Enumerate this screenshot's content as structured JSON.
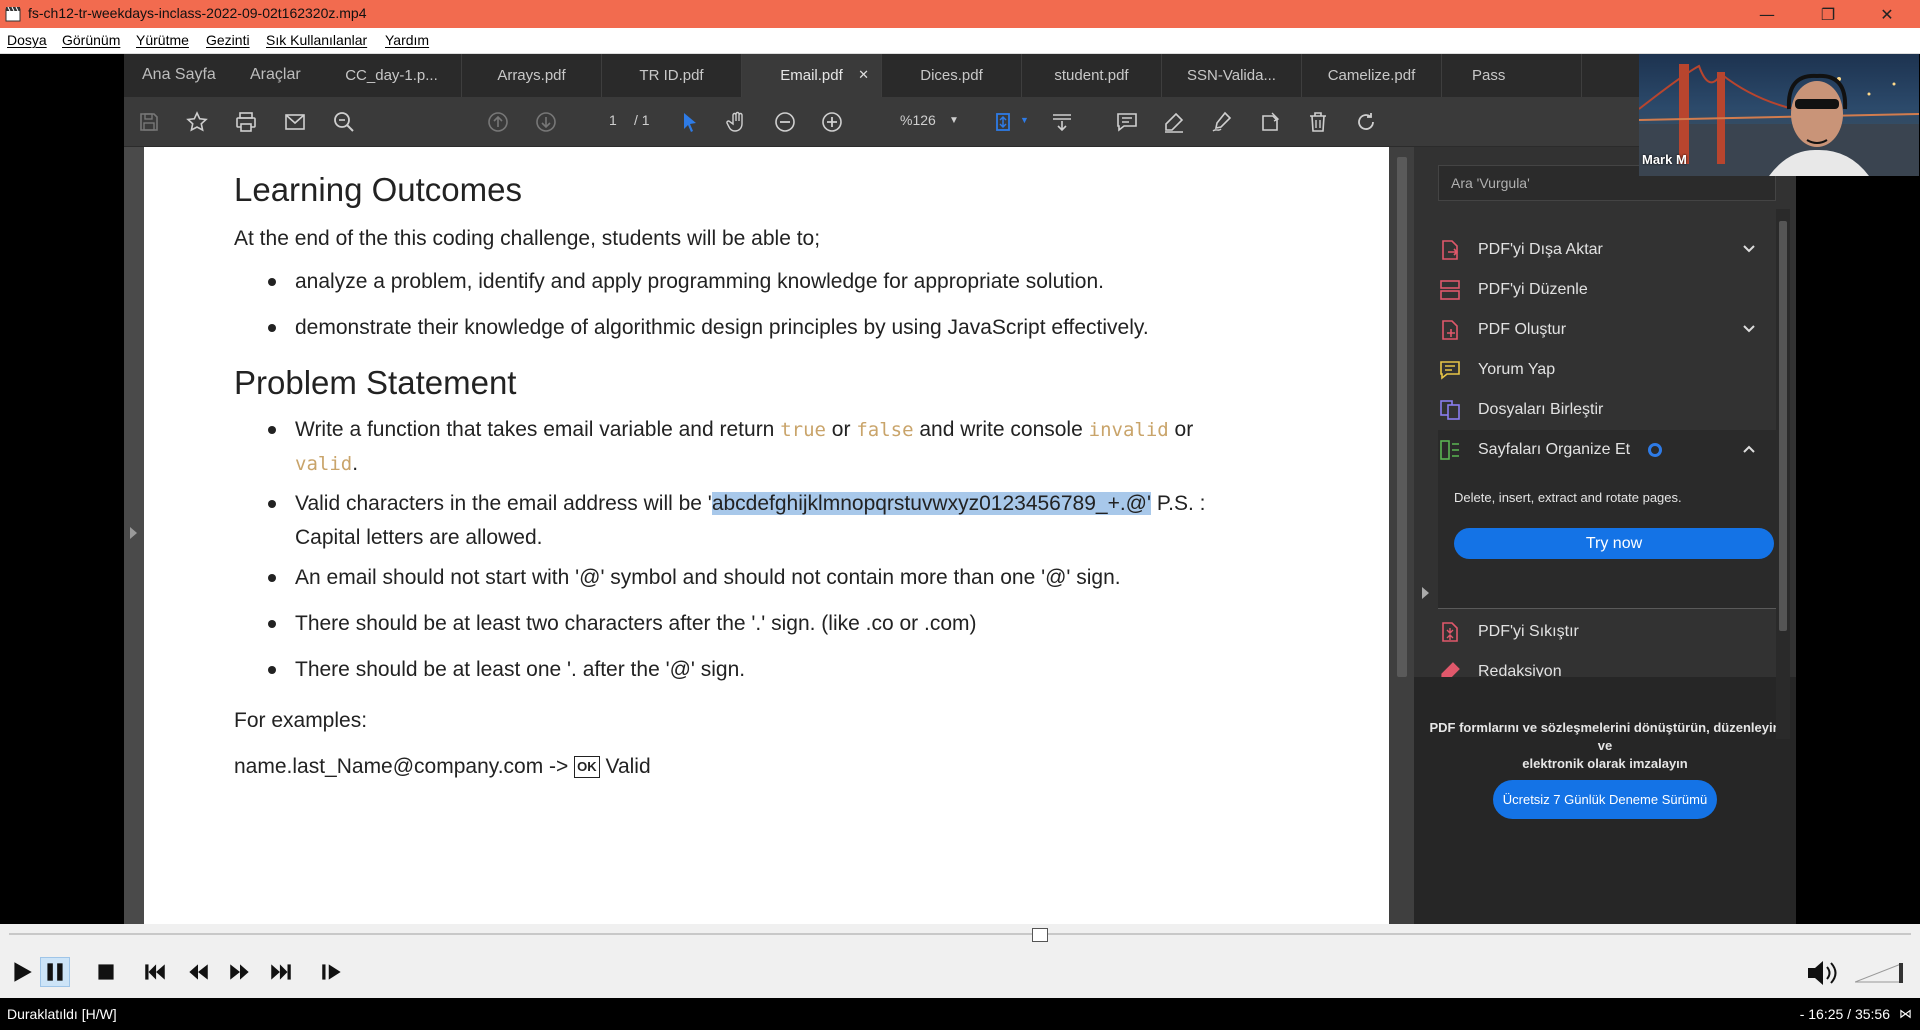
{
  "window": {
    "title": "fs-ch12-tr-weekdays-inclass-2022-09-02t162320z.mp4",
    "controls": {
      "minimize": "—",
      "maximize": "❐",
      "close": "✕"
    }
  },
  "menu": [
    "Dosya",
    "Görünüm",
    "Yürütme",
    "Gezinti",
    "Sık Kullanılanlar",
    "Yardım"
  ],
  "acrobat": {
    "nav": {
      "home": "Ana Sayfa",
      "tools": "Araçlar"
    },
    "tabs": [
      {
        "label": "CC_day-1.p...",
        "active": false
      },
      {
        "label": "Arrays.pdf",
        "active": false
      },
      {
        "label": "TR ID.pdf",
        "active": false
      },
      {
        "label": "Email.pdf",
        "active": true,
        "close": "✕"
      },
      {
        "label": "Dices.pdf",
        "active": false
      },
      {
        "label": "student.pdf",
        "active": false
      },
      {
        "label": "SSN-Valida...",
        "active": false
      },
      {
        "label": "Camelize.pdf",
        "active": false
      },
      {
        "label": "Pass",
        "active": false
      }
    ],
    "toolbar": {
      "page_current": "1",
      "page_total": "/ 1",
      "zoom": "%126",
      "icons": [
        "save-icon",
        "star-icon",
        "print-icon",
        "mail-icon",
        "search-zoom-icon",
        "page-up-icon",
        "page-down-icon",
        "select-cursor-icon",
        "hand-icon",
        "zoom-out-icon",
        "zoom-in-icon",
        "fit-page-icon",
        "scroll-mode-icon",
        "comment-icon",
        "highlight-pen-icon",
        "sign-icon",
        "share-icon",
        "delete-icon",
        "rotate-icon"
      ]
    },
    "document": {
      "heading1": "Learning Outcomes",
      "intro": "At the end of the this coding challenge, students will be able to;",
      "outcomes": [
        "analyze a problem, identify and apply programming knowledge for appropriate solution.",
        "demonstrate their knowledge of algorithmic design principles by using JavaScript effectively."
      ],
      "heading2": "Problem Statement",
      "problem": {
        "item1_a": "Write a function that takes email variable and return ",
        "item1_true": "true",
        "item1_or1": " or ",
        "item1_false": "false",
        "item1_b": " and write console ",
        "item1_invalid": "invalid",
        "item1_or2": " or",
        "item1_valid": "valid",
        "item1_end": ".",
        "item2_a": "Valid characters in the email address will be '",
        "item2_highlight": "abcdefghijklmnopqrstuvwxyz0123456789_+.@'",
        "item2_b": " P.S. :",
        "item2_c": "Capital letters are allowed.",
        "item3": "An email should not start with '@' symbol and should not contain more than one '@' sign.",
        "item4": "There should be at least two characters after the '.' sign. (like .co or .com)",
        "item5": "There should be at least one '. after the '@' sign."
      },
      "examples_label": "For examples:",
      "example1_text": "name.last_Name@company.com ->",
      "example1_ok": "OK",
      "example1_result": "Valid"
    },
    "right_panel": {
      "search_placeholder": "Ara 'Vurgula'",
      "items": [
        {
          "label": "PDF'yi Dışa Aktar",
          "icon": "export-pdf-icon",
          "color": "#e0586b",
          "chevron": "down"
        },
        {
          "label": "PDF'yi Düzenle",
          "icon": "edit-pdf-icon",
          "color": "#e0586b"
        },
        {
          "label": "PDF Oluştur",
          "icon": "create-pdf-icon",
          "color": "#e0586b",
          "chevron": "down"
        },
        {
          "label": "Yorum Yap",
          "icon": "comment-icon",
          "color": "#e8c547"
        },
        {
          "label": "Dosyaları Birleştir",
          "icon": "combine-files-icon",
          "color": "#8a7ef0"
        },
        {
          "label": "Sayfaları Organize Et",
          "icon": "organize-pages-icon",
          "color": "#5ab552",
          "chevron": "up"
        }
      ],
      "expanded_desc": "Delete, insert, extract and rotate pages.",
      "try_now": "Try now",
      "items_after": [
        {
          "label": "PDF'yi Sıkıştır",
          "icon": "compress-pdf-icon",
          "color": "#e0586b"
        },
        {
          "label": "Redaksiyon",
          "icon": "redact-icon",
          "color": "#e0586b"
        }
      ],
      "promo_line1": "PDF formlarını ve sözleşmelerini dönüştürün, düzenleyin",
      "promo_line2": "ve",
      "promo_line3": "elektronik olarak imzalayın",
      "trial_button": "Ücretsiz 7 Günlük Deneme Sürümü"
    },
    "webcam": {
      "name": "Mark M"
    }
  },
  "player": {
    "seek_fraction": 0.542,
    "controls": [
      "play-icon",
      "pause-icon",
      "stop-icon",
      "previous-icon",
      "rewind-icon",
      "fast-forward-icon",
      "next-icon",
      "frame-step-icon"
    ],
    "status_left": "Duraklatıldı [H/W]",
    "status_right": "- 16:25 / 35:56",
    "status_symbol": "⋈"
  },
  "colors": {
    "titlebar": "#f26b4f",
    "accent_blue": "#1473e6",
    "code": "#c9a46a",
    "selection": "#a8c8ea"
  }
}
